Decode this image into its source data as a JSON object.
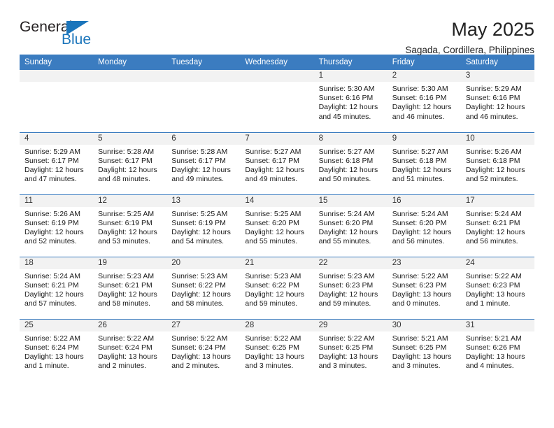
{
  "brand": {
    "name_part1": "General",
    "name_part2": "Blue",
    "accent_color": "#1b75bb"
  },
  "header": {
    "title": "May 2025",
    "subtitle": "Sagada, Cordillera, Philippines"
  },
  "theme": {
    "header_row_bg": "#3b7cc0",
    "daynum_band_bg": "#f2f2f2",
    "cell_bg": "#ffffff",
    "text_color": "#1a1a1a"
  },
  "weekdays": [
    "Sunday",
    "Monday",
    "Tuesday",
    "Wednesday",
    "Thursday",
    "Friday",
    "Saturday"
  ],
  "weeks": [
    [
      {
        "day": "",
        "empty": true
      },
      {
        "day": "",
        "empty": true
      },
      {
        "day": "",
        "empty": true
      },
      {
        "day": "",
        "empty": true
      },
      {
        "day": "1",
        "sunrise": "Sunrise: 5:30 AM",
        "sunset": "Sunset: 6:16 PM",
        "daylight_1": "Daylight: 12 hours",
        "daylight_2": "and 45 minutes."
      },
      {
        "day": "2",
        "sunrise": "Sunrise: 5:30 AM",
        "sunset": "Sunset: 6:16 PM",
        "daylight_1": "Daylight: 12 hours",
        "daylight_2": "and 46 minutes."
      },
      {
        "day": "3",
        "sunrise": "Sunrise: 5:29 AM",
        "sunset": "Sunset: 6:16 PM",
        "daylight_1": "Daylight: 12 hours",
        "daylight_2": "and 46 minutes."
      }
    ],
    [
      {
        "day": "4",
        "sunrise": "Sunrise: 5:29 AM",
        "sunset": "Sunset: 6:17 PM",
        "daylight_1": "Daylight: 12 hours",
        "daylight_2": "and 47 minutes."
      },
      {
        "day": "5",
        "sunrise": "Sunrise: 5:28 AM",
        "sunset": "Sunset: 6:17 PM",
        "daylight_1": "Daylight: 12 hours",
        "daylight_2": "and 48 minutes."
      },
      {
        "day": "6",
        "sunrise": "Sunrise: 5:28 AM",
        "sunset": "Sunset: 6:17 PM",
        "daylight_1": "Daylight: 12 hours",
        "daylight_2": "and 49 minutes."
      },
      {
        "day": "7",
        "sunrise": "Sunrise: 5:27 AM",
        "sunset": "Sunset: 6:17 PM",
        "daylight_1": "Daylight: 12 hours",
        "daylight_2": "and 49 minutes."
      },
      {
        "day": "8",
        "sunrise": "Sunrise: 5:27 AM",
        "sunset": "Sunset: 6:18 PM",
        "daylight_1": "Daylight: 12 hours",
        "daylight_2": "and 50 minutes."
      },
      {
        "day": "9",
        "sunrise": "Sunrise: 5:27 AM",
        "sunset": "Sunset: 6:18 PM",
        "daylight_1": "Daylight: 12 hours",
        "daylight_2": "and 51 minutes."
      },
      {
        "day": "10",
        "sunrise": "Sunrise: 5:26 AM",
        "sunset": "Sunset: 6:18 PM",
        "daylight_1": "Daylight: 12 hours",
        "daylight_2": "and 52 minutes."
      }
    ],
    [
      {
        "day": "11",
        "sunrise": "Sunrise: 5:26 AM",
        "sunset": "Sunset: 6:19 PM",
        "daylight_1": "Daylight: 12 hours",
        "daylight_2": "and 52 minutes."
      },
      {
        "day": "12",
        "sunrise": "Sunrise: 5:25 AM",
        "sunset": "Sunset: 6:19 PM",
        "daylight_1": "Daylight: 12 hours",
        "daylight_2": "and 53 minutes."
      },
      {
        "day": "13",
        "sunrise": "Sunrise: 5:25 AM",
        "sunset": "Sunset: 6:19 PM",
        "daylight_1": "Daylight: 12 hours",
        "daylight_2": "and 54 minutes."
      },
      {
        "day": "14",
        "sunrise": "Sunrise: 5:25 AM",
        "sunset": "Sunset: 6:20 PM",
        "daylight_1": "Daylight: 12 hours",
        "daylight_2": "and 55 minutes."
      },
      {
        "day": "15",
        "sunrise": "Sunrise: 5:24 AM",
        "sunset": "Sunset: 6:20 PM",
        "daylight_1": "Daylight: 12 hours",
        "daylight_2": "and 55 minutes."
      },
      {
        "day": "16",
        "sunrise": "Sunrise: 5:24 AM",
        "sunset": "Sunset: 6:20 PM",
        "daylight_1": "Daylight: 12 hours",
        "daylight_2": "and 56 minutes."
      },
      {
        "day": "17",
        "sunrise": "Sunrise: 5:24 AM",
        "sunset": "Sunset: 6:21 PM",
        "daylight_1": "Daylight: 12 hours",
        "daylight_2": "and 56 minutes."
      }
    ],
    [
      {
        "day": "18",
        "sunrise": "Sunrise: 5:24 AM",
        "sunset": "Sunset: 6:21 PM",
        "daylight_1": "Daylight: 12 hours",
        "daylight_2": "and 57 minutes."
      },
      {
        "day": "19",
        "sunrise": "Sunrise: 5:23 AM",
        "sunset": "Sunset: 6:21 PM",
        "daylight_1": "Daylight: 12 hours",
        "daylight_2": "and 58 minutes."
      },
      {
        "day": "20",
        "sunrise": "Sunrise: 5:23 AM",
        "sunset": "Sunset: 6:22 PM",
        "daylight_1": "Daylight: 12 hours",
        "daylight_2": "and 58 minutes."
      },
      {
        "day": "21",
        "sunrise": "Sunrise: 5:23 AM",
        "sunset": "Sunset: 6:22 PM",
        "daylight_1": "Daylight: 12 hours",
        "daylight_2": "and 59 minutes."
      },
      {
        "day": "22",
        "sunrise": "Sunrise: 5:23 AM",
        "sunset": "Sunset: 6:23 PM",
        "daylight_1": "Daylight: 12 hours",
        "daylight_2": "and 59 minutes."
      },
      {
        "day": "23",
        "sunrise": "Sunrise: 5:22 AM",
        "sunset": "Sunset: 6:23 PM",
        "daylight_1": "Daylight: 13 hours",
        "daylight_2": "and 0 minutes."
      },
      {
        "day": "24",
        "sunrise": "Sunrise: 5:22 AM",
        "sunset": "Sunset: 6:23 PM",
        "daylight_1": "Daylight: 13 hours",
        "daylight_2": "and 1 minute."
      }
    ],
    [
      {
        "day": "25",
        "sunrise": "Sunrise: 5:22 AM",
        "sunset": "Sunset: 6:24 PM",
        "daylight_1": "Daylight: 13 hours",
        "daylight_2": "and 1 minute."
      },
      {
        "day": "26",
        "sunrise": "Sunrise: 5:22 AM",
        "sunset": "Sunset: 6:24 PM",
        "daylight_1": "Daylight: 13 hours",
        "daylight_2": "and 2 minutes."
      },
      {
        "day": "27",
        "sunrise": "Sunrise: 5:22 AM",
        "sunset": "Sunset: 6:24 PM",
        "daylight_1": "Daylight: 13 hours",
        "daylight_2": "and 2 minutes."
      },
      {
        "day": "28",
        "sunrise": "Sunrise: 5:22 AM",
        "sunset": "Sunset: 6:25 PM",
        "daylight_1": "Daylight: 13 hours",
        "daylight_2": "and 3 minutes."
      },
      {
        "day": "29",
        "sunrise": "Sunrise: 5:22 AM",
        "sunset": "Sunset: 6:25 PM",
        "daylight_1": "Daylight: 13 hours",
        "daylight_2": "and 3 minutes."
      },
      {
        "day": "30",
        "sunrise": "Sunrise: 5:21 AM",
        "sunset": "Sunset: 6:25 PM",
        "daylight_1": "Daylight: 13 hours",
        "daylight_2": "and 3 minutes."
      },
      {
        "day": "31",
        "sunrise": "Sunrise: 5:21 AM",
        "sunset": "Sunset: 6:26 PM",
        "daylight_1": "Daylight: 13 hours",
        "daylight_2": "and 4 minutes."
      }
    ]
  ]
}
